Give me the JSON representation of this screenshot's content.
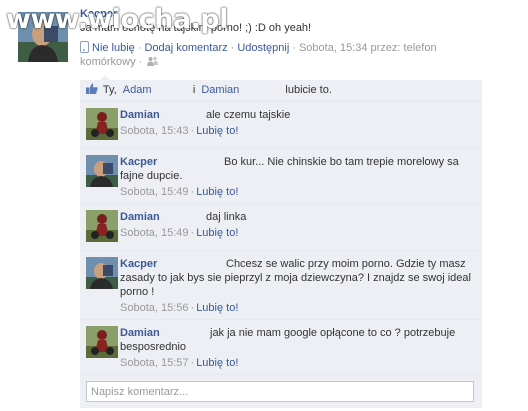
{
  "watermark": "www.wiocha.pl",
  "post": {
    "author": "Kacper",
    "text": "Ja mam ochotę na tajskim porno! ;) :D oh yeah!",
    "actions": {
      "unlike": "Nie lubię",
      "comment": "Dodaj komentarz",
      "share": "Udostępnij"
    },
    "timestamp": "Sobota, 15:34 przez: telefon komórkowy",
    "sep": "·"
  },
  "likes": {
    "prefix": "Ty,",
    "name1": "Adam",
    "conj": "i",
    "name2": "Damian",
    "suffix": "lubicie to."
  },
  "comments": [
    {
      "author": "Damian",
      "text": "ale czemu tajskie",
      "time": "Sobota, 15:43",
      "like": "Lubię to!"
    },
    {
      "author": "Kacper",
      "text": "Bo kur... Nie chinskie bo tam trepie morelowy sa fajne dupcie.",
      "time": "Sobota, 15:49",
      "like": "Lubię to!"
    },
    {
      "author": "Damian",
      "text": "daj linka",
      "time": "Sobota, 15:49",
      "like": "Lubię to!"
    },
    {
      "author": "Kacper",
      "text": "Chcesz se walic przy moim porno. Gdzie ty masz zasady to jak bys sie pieprzyl z moja dziewczyna? I znajdz se swoj ideal porno !",
      "time": "Sobota, 15:56",
      "like": "Lubię to!"
    },
    {
      "author": "Damian",
      "text": "jak ja nie mam google opłącone to co ? potrzebuje besposrednio",
      "time": "Sobota, 15:57",
      "like": "Lubię to!"
    }
  ],
  "comment_input": {
    "placeholder": "Napisz komentarz..."
  },
  "colors": {
    "link": "#3b5998",
    "ufi_bg": "#edeff4",
    "meta": "#999999"
  }
}
